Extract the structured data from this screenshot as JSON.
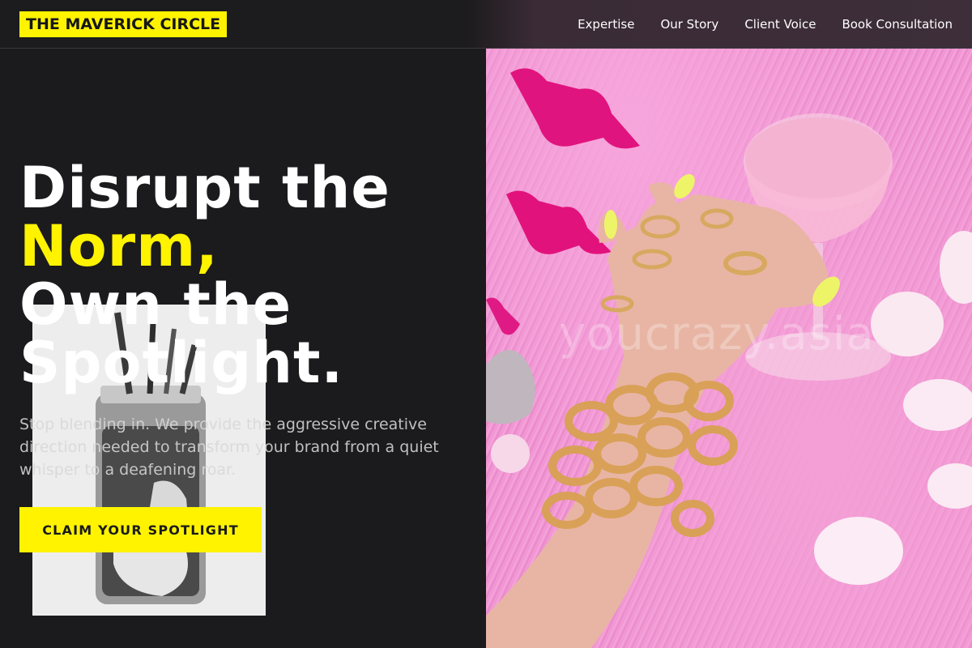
{
  "header": {
    "logo_text": "THE MAVERICK CIRCLE",
    "nav": [
      {
        "label": "Expertise"
      },
      {
        "label": "Our Story"
      },
      {
        "label": "Client Voice"
      },
      {
        "label": "Book Consultation"
      }
    ]
  },
  "hero": {
    "headline_line1": "Disrupt the",
    "headline_highlight": "Norm,",
    "headline_line3": "Own the",
    "headline_line4": "Spotlight.",
    "subtext": "Stop blending in. We provide the aggressive creative direction needed to transform your brand from a quiet whisper to a deafening roar.",
    "cta_label": "CLAIM YOUR SPOTLIGHT",
    "watermark": "youcrazy.asia"
  },
  "colors": {
    "accent": "#fff300",
    "background": "#1b1a1c",
    "text": "#ffffff"
  }
}
